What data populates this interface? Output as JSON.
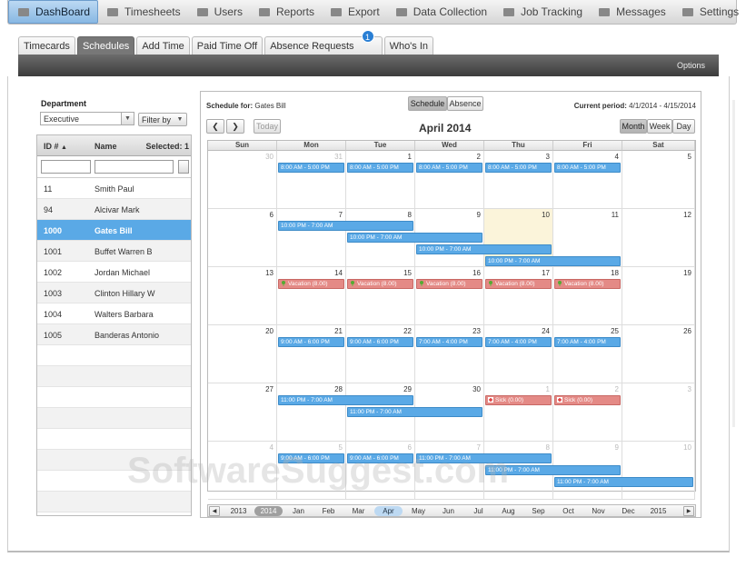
{
  "nav": {
    "items": [
      {
        "label": "DashBoard",
        "icon": "dashboard-icon",
        "active": true
      },
      {
        "label": "Timesheets",
        "icon": "timesheet-grid-icon"
      },
      {
        "label": "Users",
        "icon": "user-icon"
      },
      {
        "label": "Reports",
        "icon": "bar-chart-icon"
      },
      {
        "label": "Export",
        "icon": "export-arrow-icon"
      },
      {
        "label": "Data Collection",
        "icon": "data-collection-icon"
      },
      {
        "label": "Job Tracking",
        "icon": "job-tracking-icon"
      },
      {
        "label": "Messages",
        "icon": "speech-bubble-icon"
      },
      {
        "label": "Settings",
        "icon": "tools-icon"
      }
    ]
  },
  "subtabs": {
    "items": [
      {
        "label": "Timecards"
      },
      {
        "label": "Schedules",
        "active": true
      },
      {
        "label": "Add Time"
      },
      {
        "label": "Paid Time Off"
      },
      {
        "label": "Absence Requests",
        "badge": "1"
      },
      {
        "label": "Who's In"
      }
    ]
  },
  "options_label": "Options",
  "left": {
    "department_label": "Department",
    "department_value": "Executive",
    "filter_label": "Filter by",
    "col_id": "ID #",
    "col_name": "Name",
    "col_selected": "Selected: 1",
    "employees": [
      {
        "id": "11",
        "name": "Smith Paul"
      },
      {
        "id": "94",
        "name": "Alcivar Mark"
      },
      {
        "id": "1000",
        "name": "Gates Bill",
        "selected": true
      },
      {
        "id": "1001",
        "name": "Buffet Warren B"
      },
      {
        "id": "1002",
        "name": "Jordan Michael"
      },
      {
        "id": "1003",
        "name": "Clinton Hillary W"
      },
      {
        "id": "1004",
        "name": "Walters Barbara"
      },
      {
        "id": "1005",
        "name": "Banderas Antonio"
      }
    ]
  },
  "calendar": {
    "schedule_for_label": "Schedule for:",
    "schedule_for_name": "Gates Bill",
    "view_schedule": "Schedule",
    "view_absence": "Absence",
    "period_label": "Current period:",
    "period_value": "4/1/2014 - 4/15/2014",
    "prev": "❮",
    "next": "❯",
    "today": "Today",
    "title": "April 2014",
    "mode_month": "Month",
    "mode_week": "Week",
    "mode_day": "Day",
    "days": [
      "Sun",
      "Mon",
      "Tue",
      "Wed",
      "Thu",
      "Fri",
      "Sat"
    ],
    "weeks": [
      [
        {
          "d": "30",
          "o": true
        },
        {
          "d": "31",
          "o": true
        },
        {
          "d": "1"
        },
        {
          "d": "2"
        },
        {
          "d": "3"
        },
        {
          "d": "4"
        },
        {
          "d": "5"
        }
      ],
      [
        {
          "d": "6"
        },
        {
          "d": "7"
        },
        {
          "d": "8"
        },
        {
          "d": "9"
        },
        {
          "d": "10",
          "today": true
        },
        {
          "d": "11"
        },
        {
          "d": "12"
        }
      ],
      [
        {
          "d": "13"
        },
        {
          "d": "14"
        },
        {
          "d": "15"
        },
        {
          "d": "16"
        },
        {
          "d": "17"
        },
        {
          "d": "18"
        },
        {
          "d": "19"
        }
      ],
      [
        {
          "d": "20"
        },
        {
          "d": "21"
        },
        {
          "d": "22"
        },
        {
          "d": "23"
        },
        {
          "d": "24"
        },
        {
          "d": "25"
        },
        {
          "d": "26"
        }
      ],
      [
        {
          "d": "27"
        },
        {
          "d": "28"
        },
        {
          "d": "29"
        },
        {
          "d": "30"
        },
        {
          "d": "1",
          "o": true
        },
        {
          "d": "2",
          "o": true
        },
        {
          "d": "3",
          "o": true
        }
      ],
      [
        {
          "d": "4",
          "o": true
        },
        {
          "d": "5",
          "o": true
        },
        {
          "d": "6",
          "o": true
        },
        {
          "d": "7",
          "o": true
        },
        {
          "d": "8",
          "o": true
        },
        {
          "d": "9",
          "o": true
        },
        {
          "d": "10",
          "o": true
        }
      ]
    ],
    "events": [
      {
        "w": 0,
        "d": 1,
        "span": 1,
        "row": 0,
        "t": "8:00 AM - 5:00 PM"
      },
      {
        "w": 0,
        "d": 2,
        "span": 1,
        "row": 0,
        "t": "8:00 AM - 5:00 PM"
      },
      {
        "w": 0,
        "d": 3,
        "span": 1,
        "row": 0,
        "t": "8:00 AM - 5:00 PM"
      },
      {
        "w": 0,
        "d": 4,
        "span": 1,
        "row": 0,
        "t": "8:00 AM - 5:00 PM"
      },
      {
        "w": 0,
        "d": 5,
        "span": 1,
        "row": 0,
        "t": "8:00 AM - 5:00 PM"
      },
      {
        "w": 1,
        "d": 1,
        "span": 2,
        "row": 0,
        "t": "10:00 PM - 7:00 AM"
      },
      {
        "w": 1,
        "d": 2,
        "span": 2,
        "row": 1,
        "t": "10:00 PM - 7:00 AM"
      },
      {
        "w": 1,
        "d": 3,
        "span": 2,
        "row": 2,
        "t": "10:00 PM - 7:00 AM"
      },
      {
        "w": 1,
        "d": 4,
        "span": 2,
        "row": 3,
        "t": "10:00 PM - 7:00 AM"
      },
      {
        "w": 2,
        "d": 1,
        "span": 1,
        "row": 0,
        "t": "Vacation (8.00)",
        "k": "vac"
      },
      {
        "w": 2,
        "d": 2,
        "span": 1,
        "row": 0,
        "t": "Vacation (8.00)",
        "k": "vac"
      },
      {
        "w": 2,
        "d": 3,
        "span": 1,
        "row": 0,
        "t": "Vacation (8.00)",
        "k": "vac"
      },
      {
        "w": 2,
        "d": 4,
        "span": 1,
        "row": 0,
        "t": "Vacation (8.00)",
        "k": "vac"
      },
      {
        "w": 2,
        "d": 5,
        "span": 1,
        "row": 0,
        "t": "Vacation (8.00)",
        "k": "vac"
      },
      {
        "w": 3,
        "d": 1,
        "span": 1,
        "row": 0,
        "t": "9:00 AM - 6:00 PM"
      },
      {
        "w": 3,
        "d": 2,
        "span": 1,
        "row": 0,
        "t": "9:00 AM - 6:00 PM"
      },
      {
        "w": 3,
        "d": 3,
        "span": 1,
        "row": 0,
        "t": "7:00 AM - 4:00 PM"
      },
      {
        "w": 3,
        "d": 4,
        "span": 1,
        "row": 0,
        "t": "7:00 AM - 4:00 PM"
      },
      {
        "w": 3,
        "d": 5,
        "span": 1,
        "row": 0,
        "t": "7:00 AM - 4:00 PM"
      },
      {
        "w": 4,
        "d": 1,
        "span": 2,
        "row": 0,
        "t": "11:00 PM - 7:00 AM"
      },
      {
        "w": 4,
        "d": 2,
        "span": 2,
        "row": 1,
        "t": "11:00 PM - 7:00 AM"
      },
      {
        "w": 4,
        "d": 4,
        "span": 1,
        "row": 0,
        "t": "Sick (0.00)",
        "k": "sick"
      },
      {
        "w": 4,
        "d": 5,
        "span": 1,
        "row": 0,
        "t": "Sick (0.00)",
        "k": "sick"
      },
      {
        "w": 5,
        "d": 1,
        "span": 1,
        "row": 0,
        "t": "9:00 AM - 6:00 PM"
      },
      {
        "w": 5,
        "d": 2,
        "span": 1,
        "row": 0,
        "t": "9:00 AM - 6:00 PM"
      },
      {
        "w": 5,
        "d": 3,
        "span": 2,
        "row": 0,
        "t": "11:00 PM - 7:00 AM"
      },
      {
        "w": 5,
        "d": 4,
        "span": 2,
        "row": 1,
        "t": "11:00 PM - 7:00 AM"
      },
      {
        "w": 5,
        "d": 5,
        "span": 2,
        "row": 2,
        "t": "11:00 PM - 7:00 AM"
      }
    ],
    "strip": [
      {
        "l": "2013"
      },
      {
        "l": "2014",
        "cur": "y"
      },
      {
        "l": "Jan"
      },
      {
        "l": "Feb"
      },
      {
        "l": "Mar"
      },
      {
        "l": "Apr",
        "cur": "m"
      },
      {
        "l": "May"
      },
      {
        "l": "Jun"
      },
      {
        "l": "Jul"
      },
      {
        "l": "Aug"
      },
      {
        "l": "Sep"
      },
      {
        "l": "Oct"
      },
      {
        "l": "Nov"
      },
      {
        "l": "Dec"
      },
      {
        "l": "2015"
      }
    ],
    "strip_prev": "◀",
    "strip_next": "▶"
  },
  "watermark": "SoftwareSuggest.com"
}
